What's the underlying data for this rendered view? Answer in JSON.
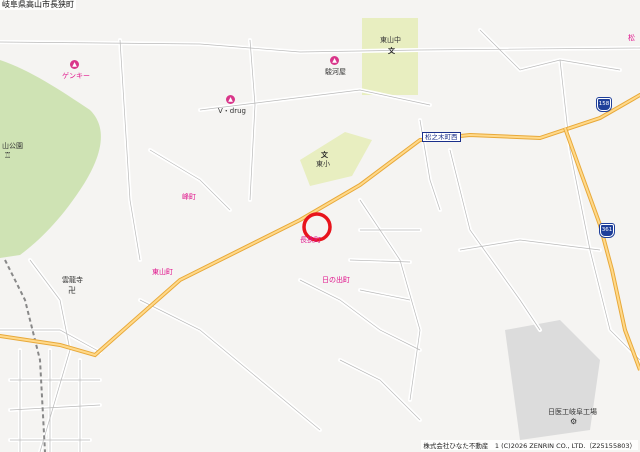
{
  "title": "岐阜県高山市長狭町",
  "credit": "株式会社ひなた不動産　1 (C)2026 ZENRIN CO., LTD.（Z25155803）",
  "route_shields": [
    "158",
    "361"
  ],
  "bus_stop": "松之木町西",
  "marker_color": "#e8141c",
  "labels": {
    "pois": {
      "genky": "ゲンキー",
      "surugaya": "駿河屋",
      "vdrug": "V・drug",
      "higashiyama_park": "山公園",
      "unryuji": "雲龍寺",
      "nikko": "日医工岐阜工場"
    },
    "schools": {
      "higashiyama_chu": "東山中",
      "higashi_sho": "東小"
    },
    "towns": {
      "kitamachi": "峰町",
      "nagasamachi": "長狭町",
      "higashiyamamachi": "東山町",
      "hinodemachi": "日の出町",
      "matsunoki": "松"
    }
  },
  "icons": {
    "poi": "shopping-bag-icon",
    "school": "school-icon",
    "temple": "temple-icon",
    "park": "park-icon",
    "factory": "factory-icon"
  }
}
